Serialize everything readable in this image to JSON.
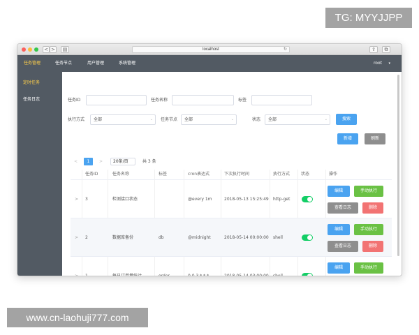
{
  "watermarks": {
    "top": "TG: MYYJJPP",
    "bottom": "www.cn-laohuji777.com"
  },
  "browser": {
    "url": "localhost",
    "back": "<",
    "forward": ">",
    "reload": "↻",
    "share": "⇪",
    "tabs": "⧉"
  },
  "topnav": {
    "items": [
      "任务管理",
      "任务节点",
      "用户管理",
      "系统管理"
    ],
    "active": 0,
    "user": "root",
    "caret": "▾"
  },
  "sidebar": {
    "items": [
      "定时任务",
      "任务日志"
    ],
    "active": 0
  },
  "filters": {
    "task_id_label": "任务ID",
    "task_id_value": "",
    "task_name_label": "任务名称",
    "task_name_value": "",
    "tag_label": "标签",
    "tag_value": "",
    "exec_mode_label": "执行方式",
    "exec_mode_value": "全部",
    "node_label": "任务节点",
    "node_value": "全部",
    "status_label": "状态",
    "status_value": "全部",
    "search_button": "搜索",
    "caret": "⌄"
  },
  "actions": {
    "add_button": "新增",
    "refresh_button": "刷新"
  },
  "pagination": {
    "prev": "<",
    "page": "1",
    "next": ">",
    "page_size": "20条/页",
    "total": "共 3 条"
  },
  "table": {
    "headers": [
      "任务ID",
      "任务名称",
      "标签",
      "cron表达式",
      "下次执行时间",
      "执行方式",
      "状态",
      "操作"
    ],
    "expand_icon": ">",
    "rows": [
      {
        "id": "3",
        "name": "检测接口状态",
        "tag": "",
        "cron": "@every 1m",
        "next": "2018-05-13 15:25:49",
        "mode": "http-get",
        "enabled": true
      },
      {
        "id": "2",
        "name": "数据库备份",
        "tag": "db",
        "cron": "@midnight",
        "next": "2018-05-14 00:00:00",
        "mode": "shell",
        "enabled": true
      },
      {
        "id": "1",
        "name": "每日订单量统计",
        "tag": "order",
        "cron": "0 0 3 * * *",
        "next": "2018-05-14 03:00:00",
        "mode": "shell",
        "enabled": true
      }
    ],
    "row_buttons": {
      "edit": "编辑",
      "run": "手动执行",
      "log": "查看日志",
      "delete": "删除"
    }
  },
  "colors": {
    "nav_bg": "#525a63",
    "active": "#ffd04b",
    "primary": "#4aa3f0",
    "success": "#6ac144",
    "danger": "#f27373",
    "info": "#8e8e8e",
    "switch_on": "#13ce66"
  }
}
